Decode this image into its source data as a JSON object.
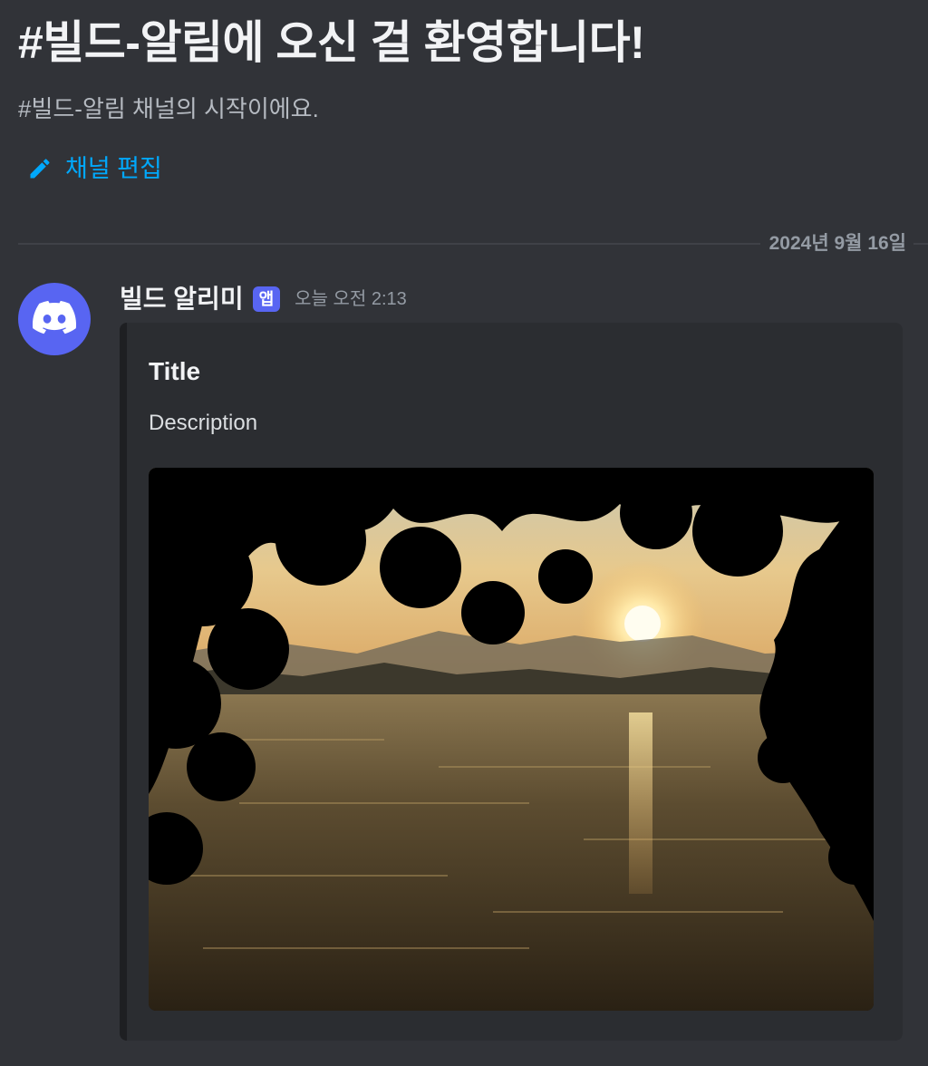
{
  "welcome": {
    "title": "#빌드-알림에 오신 걸 환영합니다!",
    "subtitle": "#빌드-알림 채널의 시작이에요.",
    "edit_label": "채널 편집",
    "edit_icon": "pencil-icon"
  },
  "divider": {
    "date": "2024년 9월 16일"
  },
  "message": {
    "author": "빌드 알리미",
    "badge": "앱",
    "timestamp": "오늘 오전 2:13",
    "avatar_icon": "discord-logo-icon",
    "embed": {
      "title": "Title",
      "description": "Description",
      "image_subject": "sunset over lake framed by tree silhouettes"
    }
  },
  "colors": {
    "background": "#313338",
    "embed_background": "#2b2d31",
    "link": "#00a8fc",
    "blurple": "#5865f2"
  }
}
